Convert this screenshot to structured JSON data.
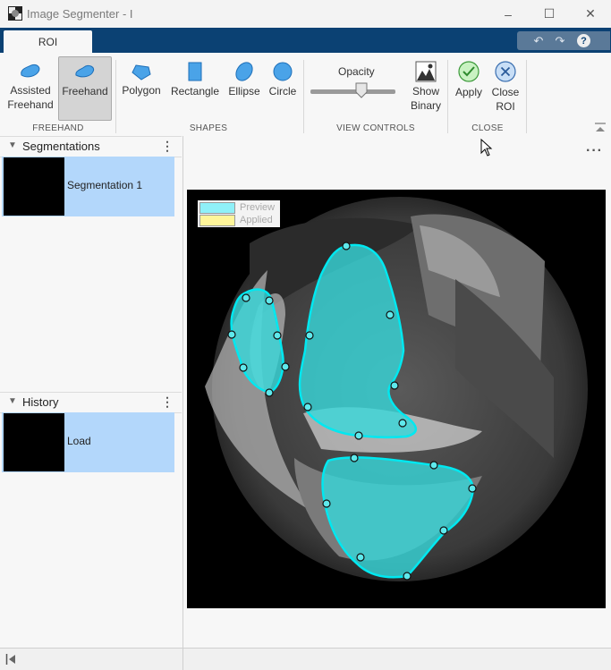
{
  "window": {
    "title": "Image Segmenter - I",
    "minimize": "–",
    "maximize": "☐",
    "close": "✕"
  },
  "tabs": [
    {
      "label": "ROI"
    }
  ],
  "qat": {
    "undo": "↶",
    "redo": "↷",
    "help": "?"
  },
  "ribbon": {
    "freehand_group": {
      "label": "FREEHAND",
      "assisted_freehand": "Assisted\nFreehand",
      "freehand": "Freehand"
    },
    "shapes_group": {
      "label": "SHAPES",
      "polygon": "Polygon",
      "rectangle": "Rectangle",
      "ellipse": "Ellipse",
      "circle": "Circle"
    },
    "view_group": {
      "label": "VIEW CONTROLS",
      "opacity": "Opacity",
      "show_binary": "Show\nBinary",
      "opacity_level": 0.6
    },
    "close_group": {
      "label": "CLOSE",
      "apply": "Apply",
      "close_roi": "Close\nROI"
    }
  },
  "segmentations_panel": {
    "title": "Segmentations",
    "items": [
      {
        "label": "Segmentation 1"
      }
    ]
  },
  "history_panel": {
    "title": "History",
    "items": [
      {
        "label": "Load"
      }
    ]
  },
  "legend": {
    "preview": "Preview",
    "applied": "Applied",
    "preview_color": "#8ff0f8",
    "applied_color": "#fff59a"
  },
  "colors": {
    "accent": "#0b4173",
    "selection": "#b3d7fb",
    "roi_fill": "#37d8db",
    "roi_stroke": "#00e0e8"
  }
}
